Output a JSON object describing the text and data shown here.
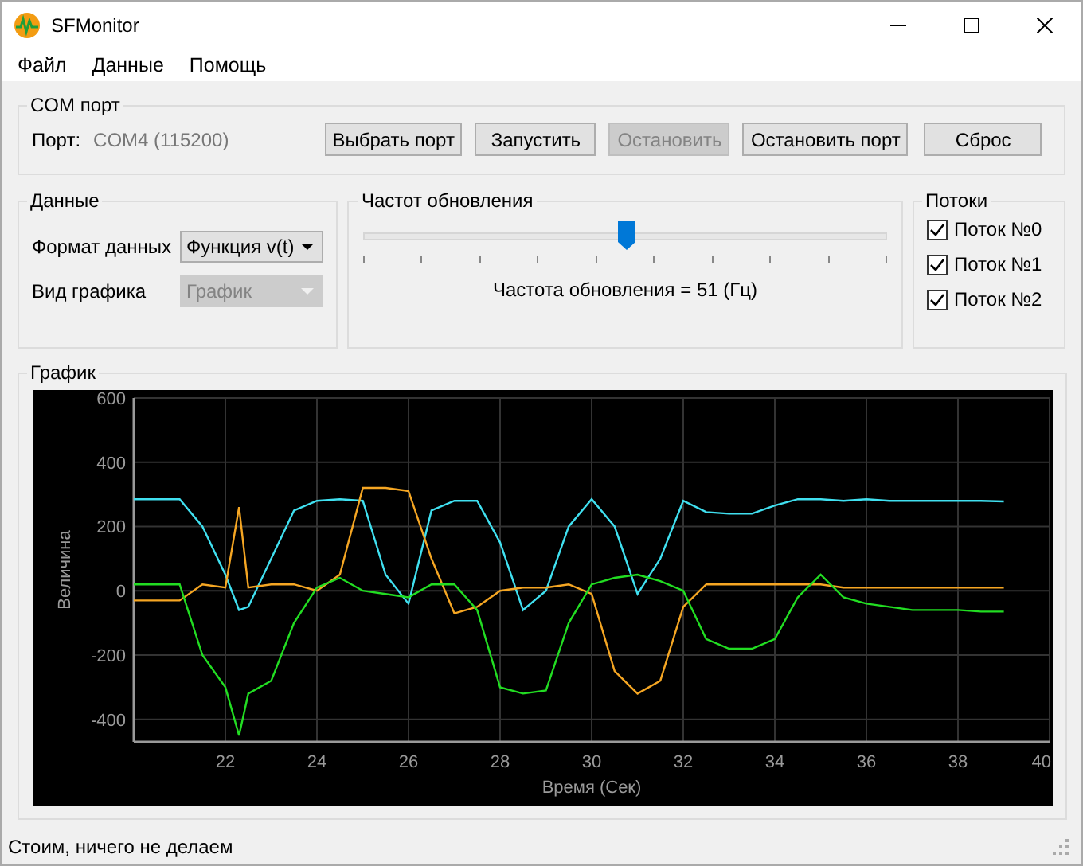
{
  "window": {
    "title": "SFMonitor"
  },
  "menu": [
    "Файл",
    "Данные",
    "Помощь"
  ],
  "com_port": {
    "title": "COM порт",
    "port_label": "Порт:",
    "port_value": "COM4 (115200)",
    "buttons": [
      {
        "label": "Выбрать порт",
        "disabled": false
      },
      {
        "label": "Запустить",
        "disabled": false
      },
      {
        "label": "Остановить",
        "disabled": true
      },
      {
        "label": "Остановить порт",
        "disabled": false
      },
      {
        "label": "Сброс",
        "disabled": false
      }
    ]
  },
  "data_group": {
    "title": "Данные",
    "fields": [
      {
        "label": "Формат данных",
        "value": "Функция v(t)",
        "disabled": false
      },
      {
        "label": "Вид графика",
        "value": "График",
        "disabled": true
      }
    ]
  },
  "rate": {
    "title": "Частот обновления",
    "level": 0.5,
    "reading": "Частота обновления = 51 (Гц)"
  },
  "streams": {
    "title": "Потоки",
    "items": [
      {
        "label": "Поток №0",
        "checked": true
      },
      {
        "label": "Поток №1",
        "checked": true
      },
      {
        "label": "Поток №2",
        "checked": true
      }
    ]
  },
  "graph": {
    "title": "График",
    "chart_data": {
      "type": "line",
      "grid": true,
      "xlabel": "Время (Сек)",
      "ylabel": "Величина",
      "xlim": [
        20,
        40
      ],
      "ylim": [
        -470,
        600
      ],
      "xticks": [
        22,
        24,
        26,
        28,
        30,
        32,
        34,
        36,
        38,
        40
      ],
      "yticks": [
        -400,
        -200,
        0,
        200,
        400,
        600
      ],
      "x": [
        20,
        20.5,
        21,
        21.5,
        22,
        22.3,
        22.5,
        23,
        23.5,
        24,
        24.5,
        25,
        25.5,
        26,
        26.5,
        27,
        27.5,
        28,
        28.5,
        29,
        29.5,
        30,
        30.5,
        31,
        31.5,
        32,
        32.5,
        33,
        33.5,
        34,
        34.5,
        35,
        35.5,
        36,
        36.5,
        37,
        37.5,
        38,
        38.5,
        39
      ],
      "series": [
        {
          "color": "#40e0f0",
          "values": [
            285,
            285,
            285,
            200,
            50,
            -60,
            -50,
            100,
            250,
            280,
            285,
            280,
            50,
            -40,
            250,
            280,
            280,
            150,
            -60,
            0,
            200,
            285,
            200,
            -10,
            100,
            280,
            245,
            240,
            240,
            265,
            285,
            285,
            280,
            285,
            280,
            280,
            280,
            280,
            280,
            278
          ]
        },
        {
          "color": "#f5a623",
          "values": [
            -30,
            -30,
            -30,
            20,
            10,
            260,
            10,
            20,
            20,
            0,
            50,
            320,
            320,
            310,
            100,
            -70,
            -50,
            0,
            10,
            10,
            20,
            -10,
            -250,
            -320,
            -280,
            -50,
            20,
            20,
            20,
            20,
            20,
            20,
            10,
            10,
            10,
            10,
            10,
            10,
            10,
            10
          ]
        },
        {
          "color": "#22dd22",
          "values": [
            20,
            20,
            20,
            -200,
            -300,
            -450,
            -320,
            -280,
            -100,
            10,
            40,
            0,
            -10,
            -20,
            20,
            20,
            -60,
            -300,
            -320,
            -310,
            -100,
            20,
            40,
            50,
            30,
            0,
            -150,
            -180,
            -180,
            -150,
            -20,
            50,
            -20,
            -40,
            -50,
            -60,
            -60,
            -60,
            -65,
            -65
          ]
        }
      ]
    }
  },
  "status_bar": "Стоим, ничего не делаем"
}
